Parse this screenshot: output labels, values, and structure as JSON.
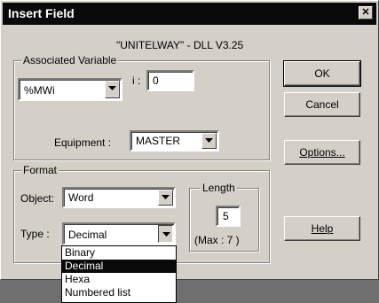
{
  "window": {
    "title": "Insert Field",
    "close_glyph": "✕"
  },
  "header": {
    "dll_label": "\"UNITELWAY\" - DLL V3.25"
  },
  "associated_variable": {
    "legend": "Associated Variable",
    "variable_value": "%MWi",
    "index_label": "i :",
    "index_value": "0",
    "equipment_label": "Equipment :",
    "equipment_value": "MASTER"
  },
  "format": {
    "legend": "Format",
    "object_label": "Object:",
    "object_value": "Word",
    "type_label": "Type :",
    "type_value": "Decimal",
    "length_legend": "Length",
    "length_value": "5",
    "max_label": "(Max : 7   )"
  },
  "buttons": {
    "ok": "OK",
    "cancel": "Cancel",
    "options": "Options...",
    "help": "Help"
  },
  "type_dropdown": {
    "options": [
      {
        "label": "Binary",
        "selected": false
      },
      {
        "label": "Decimal",
        "selected": true
      },
      {
        "label": "Hexa",
        "selected": false
      },
      {
        "label": "Numbered list",
        "selected": false
      }
    ]
  },
  "icons": {
    "dropdown_arrow": "chevron-down-icon",
    "close": "close-icon"
  },
  "colors": {
    "titlebar": "#0a0a0a",
    "face": "#d4d0c8",
    "selection": "#0a0a0a",
    "desktop": "#6f6f6f"
  }
}
